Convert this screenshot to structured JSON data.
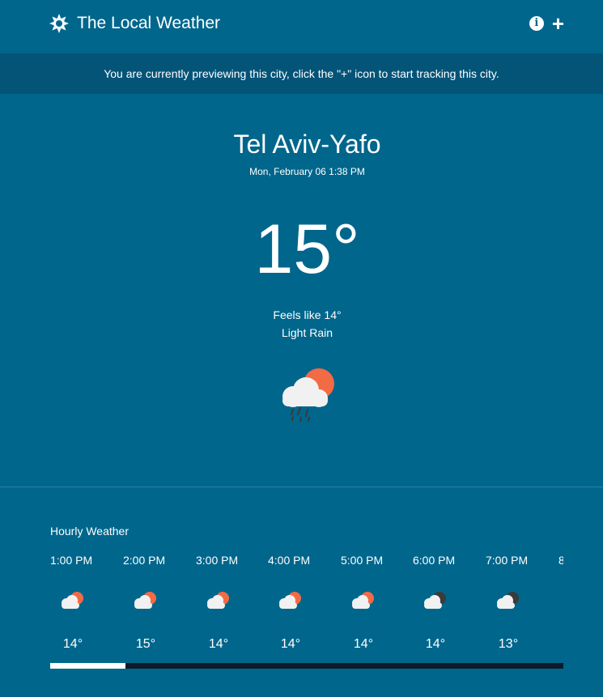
{
  "header": {
    "app_title": "The Local Weather",
    "logo_icon": "sun-gear-icon",
    "info_icon": "info-icon",
    "add_icon": "plus-icon",
    "add_glyph": "+",
    "info_glyph": "i"
  },
  "banner": {
    "text": "You are currently previewing this city, click the \"+\" icon to start tracking this city."
  },
  "current": {
    "city": "Tel Aviv-Yafo",
    "datetime": "Mon, February 06 1:38 PM",
    "temperature": "15°",
    "feels_like": "Feels like 14°",
    "condition": "Light Rain",
    "icon": "cloud-sun-rain-icon"
  },
  "hourly": {
    "title": "Hourly Weather",
    "items": [
      {
        "time": "1:00 PM",
        "temp": "14°",
        "icon": "cloud-sun-icon",
        "accent": "#f26b45"
      },
      {
        "time": "2:00 PM",
        "temp": "15°",
        "icon": "cloud-sun-icon",
        "accent": "#f26b45"
      },
      {
        "time": "3:00 PM",
        "temp": "14°",
        "icon": "cloud-sun-icon",
        "accent": "#f26b45"
      },
      {
        "time": "4:00 PM",
        "temp": "14°",
        "icon": "cloud-sun-icon",
        "accent": "#f26b45"
      },
      {
        "time": "5:00 PM",
        "temp": "14°",
        "icon": "cloud-sun-icon",
        "accent": "#f26b45"
      },
      {
        "time": "6:00 PM",
        "temp": "14°",
        "icon": "cloud-moon-icon",
        "accent": "#3b3b3b"
      },
      {
        "time": "7:00 PM",
        "temp": "13°",
        "icon": "cloud-moon-icon",
        "accent": "#3b3b3b"
      },
      {
        "time": "8",
        "temp": "",
        "icon": "",
        "accent": ""
      }
    ]
  },
  "scroll": {
    "position_fraction": 0.0,
    "visible_fraction": 0.147
  },
  "colors": {
    "background": "#00668c",
    "banner": "#045478",
    "sun_orange": "#f26b45",
    "cloud": "#f1f1f1",
    "track": "#0b1b29"
  }
}
